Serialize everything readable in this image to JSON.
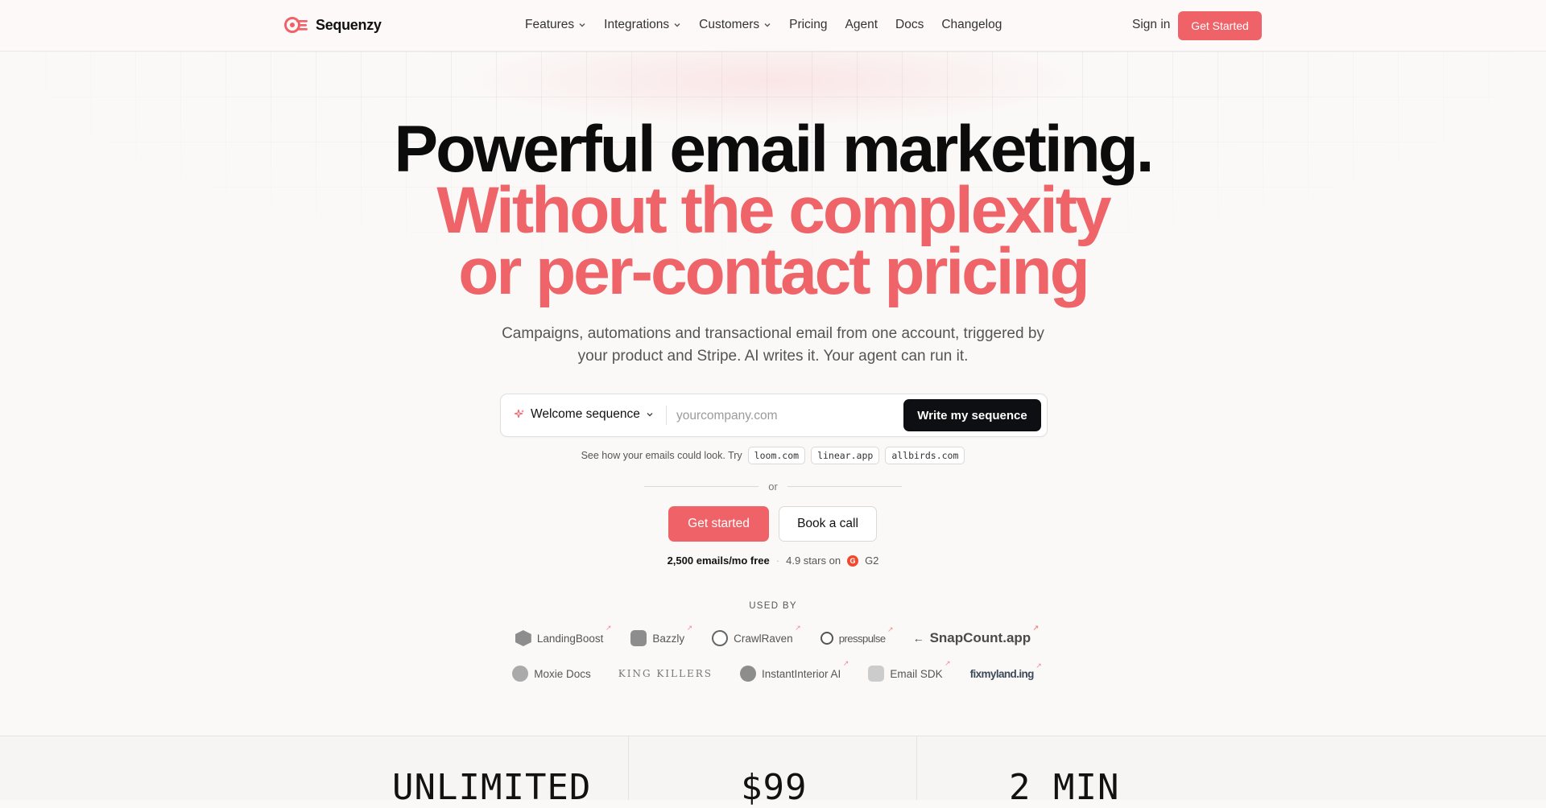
{
  "nav": {
    "logo_text": "Sequenzy",
    "links": [
      {
        "label": "Features",
        "dropdown": true
      },
      {
        "label": "Integrations",
        "dropdown": true
      },
      {
        "label": "Customers",
        "dropdown": true
      },
      {
        "label": "Pricing",
        "dropdown": false
      },
      {
        "label": "Agent",
        "dropdown": false
      },
      {
        "label": "Docs",
        "dropdown": false
      },
      {
        "label": "Changelog",
        "dropdown": false
      }
    ],
    "sign_in": "Sign in",
    "cta": "Get Started"
  },
  "hero": {
    "line1": "Powerful email marketing.",
    "line2": "Without the complexity",
    "line3": "or per-contact pricing",
    "subtitle": "Campaigns, automations and transactional email from one account, triggered by your product and Stripe. AI writes it. Your agent can run it."
  },
  "form": {
    "sequence_select": "Welcome sequence",
    "input_placeholder": "yourcompany.com",
    "input_value": "",
    "submit": "Write my sequence"
  },
  "try": {
    "label": "See how your emails could look. Try",
    "chips": [
      "loom.com",
      "linear.app",
      "allbirds.com"
    ]
  },
  "or_text": "or",
  "cta": {
    "primary": "Get started",
    "secondary": "Book a call"
  },
  "proof": {
    "free": "2,500 emails/mo free",
    "stars": "4.9 stars on",
    "g2": "G2"
  },
  "used_by": {
    "label": "USED BY",
    "row1": [
      "LandingBoost",
      "Bazzly",
      "CrawlRaven",
      "presspulse",
      "SnapCount.app"
    ],
    "row2": [
      "Moxie Docs",
      "KING KILLERS",
      "InstantInterior AI",
      "Email SDK",
      "fixmyland.ing"
    ]
  },
  "stats": [
    "UNLIMITED",
    "$99",
    "2 MIN"
  ],
  "colors": {
    "accent": "#ef6368",
    "dark": "#0e0f12"
  }
}
